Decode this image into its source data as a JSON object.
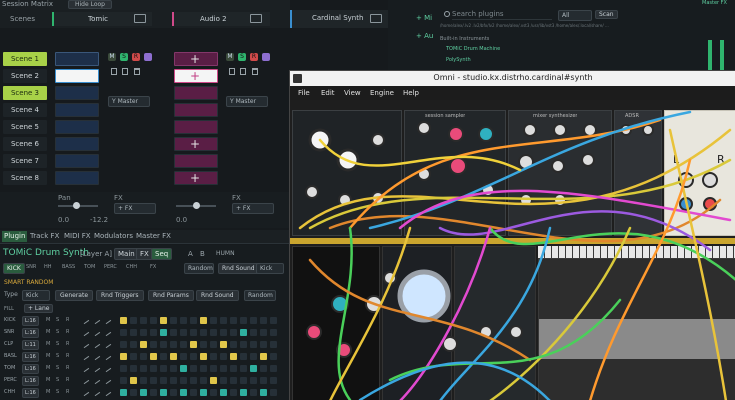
{
  "matrix": {
    "title": "Session Matrix",
    "fold_button": "Hide Loop",
    "tracks": [
      {
        "name": "Tomic",
        "color": "#2fb46e"
      },
      {
        "name": "Audio 2",
        "color": "#d04a8a"
      },
      {
        "name": "Cardinal Synth",
        "color": "#3a8fd0"
      }
    ],
    "scenes": [
      "Scene 1",
      "Scene 2",
      "Scene 3",
      "Scene 4",
      "Scene 5",
      "Scene 6",
      "Scene 7",
      "Scene 8"
    ],
    "mix_labels": {
      "m": "M",
      "s": "S",
      "r": "R"
    },
    "device_labels": [
      "Y Master",
      "Y Master"
    ],
    "pan_label": "Pan",
    "gain_left": "0.0",
    "gain_right": "-12.2",
    "fx_label": "FX",
    "add_fx": "+ FX",
    "add_fx_track": "+ FX"
  },
  "lower": {
    "tabs": [
      "Plugin",
      "Track FX",
      "MIDI FX",
      "Modulators",
      "Master FX"
    ],
    "plugin_name": "TOMiC Drum Synth",
    "plugin_layer": "[Layer A]",
    "buttons": [
      "Main",
      "FX",
      "Seq"
    ],
    "option_a": "A",
    "option_b": "B",
    "humanize": "HUMN",
    "kit_label": "KICK",
    "row_tags": [
      "SNR",
      "HH",
      "BASS",
      "TOM",
      "PERC",
      "CHH",
      "FX"
    ],
    "random_dd": "Random",
    "rnd_sound": "Rnd Sound",
    "kick_dd": "Kick",
    "smart_random": "SMART RANDOM",
    "type_label": "Type",
    "type_value": "Kick",
    "actions": [
      "Generate",
      "Rnd Triggers",
      "Rnd Params",
      "Rnd Sound"
    ],
    "action_dd": "Random",
    "fill_label": "FILL",
    "fill_value": "+ Lane",
    "lanes": [
      {
        "name": "KICK",
        "len": "L:16"
      },
      {
        "name": "SNR",
        "len": "L:16"
      },
      {
        "name": "CLP",
        "len": "L:11"
      },
      {
        "name": "BASL",
        "len": "L:16"
      },
      {
        "name": "TOM",
        "len": "L:16"
      },
      {
        "name": "PERC",
        "len": "L:16"
      },
      {
        "name": "CHH",
        "len": "L:16"
      }
    ],
    "lane_flags": [
      "M",
      "S",
      "R"
    ]
  },
  "browser": {
    "add_label": "+ Mi",
    "aux_label": "+ Au",
    "search_placeholder": "Search plugins",
    "filter": "All",
    "scan": "Scan",
    "path_hint": "/home/alex/.lv2 .lv2/bfx/lv2 /home/alex/.vst3 /usr/lib/vst3 /home/alex/.local/share/ ...",
    "section": "Built-in Instruments",
    "items": [
      "TOMiC Drum Machine",
      "PolySynth"
    ],
    "meter_label": "Master FX"
  },
  "cardinal": {
    "window_title": "Omni - studio.kx.distrho.cardinal#synth",
    "menu": [
      "File",
      "Edit",
      "View",
      "Engine",
      "Help"
    ],
    "module_labels": [
      "session sampler",
      "mixer synthesizer",
      "ADSR"
    ],
    "right_labels": [
      "L",
      "R"
    ]
  }
}
